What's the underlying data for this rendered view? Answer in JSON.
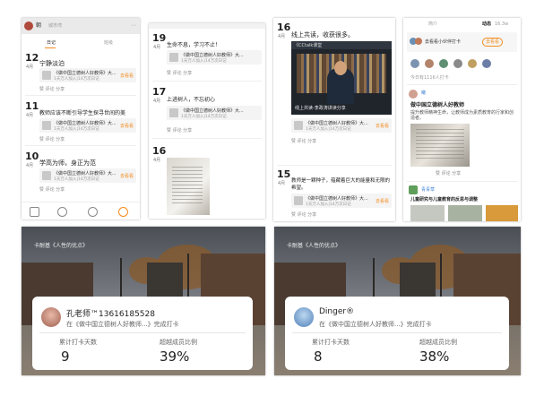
{
  "panel1": {
    "user": "朝",
    "user_sub": "城市湾",
    "tabs": [
      "日记",
      "班级"
    ],
    "entries": [
      {
        "day": "12",
        "month": "4月",
        "text": "宁静淡泊",
        "card_l1": "《做中国立德树人好教师》大...",
        "card_l2": "1天万人加入|14万次日记",
        "actions": "赞  评论  分享",
        "go": "去看看"
      },
      {
        "day": "11",
        "month": "4月",
        "text": "教师应该不断引导学生探寻世间的美",
        "card_l1": "《做中国立德树人好教师》大...",
        "card_l2": "1天万人加入|14万次日记",
        "actions": "赞  评论  分享",
        "go": "去看看"
      },
      {
        "day": "10",
        "month": "4月",
        "text": "学高为师，身正为范",
        "card_l1": "《做中国立德树人好教师》大...",
        "card_l2": "1天万人加入|14万次日记",
        "actions": "赞  评论  分享",
        "go": "去看看"
      }
    ]
  },
  "panel2": {
    "entries": [
      {
        "day": "19",
        "month": "4月",
        "text": "生命不息，学习不止！",
        "card_l1": "《做中国立德树人好教师》大...",
        "card_l2": "1天万人加入|14万次日记",
        "actions": "赞  评论  分享"
      },
      {
        "day": "17",
        "month": "4月",
        "text": "上进树人，不忘初心",
        "card_l1": "《做中国立德树人好教师》大...",
        "card_l2": "1天万人加入|14万次日记",
        "actions": "赞  评论  分享"
      },
      {
        "day": "16",
        "month": "4月",
        "text": "",
        "card_l1": "",
        "card_l2": "",
        "actions": ""
      }
    ]
  },
  "panel3": {
    "entries": [
      {
        "day": "16",
        "month": "4月",
        "text": "线上共读，收获很多。",
        "video_bar": "《CCtalk课堂",
        "caption": "线上共读-李政涛讲读分享",
        "card_l1": "《做中国立德树人好教师》大...",
        "card_l2": "1天万人加入|14万次日记",
        "actions": "赞  评论  分享",
        "go": "去看看"
      },
      {
        "day": "15",
        "month": "4月",
        "text": "教师是一颗种子，蕴藏着巨大的能量和无限的希望。",
        "card_l1": "《做中国立德树人好教师》大...",
        "card_l2": "1天万人加入|14万次日记",
        "actions": "赞  评论  分享",
        "go": "去看看"
      }
    ]
  },
  "panel4": {
    "tab_left": "简介",
    "tab_right": "动态",
    "right_count": "16.3w",
    "header_text": "去看看小伙伴打卡",
    "follow": "去看看",
    "today_text": "今日有1116人打卡",
    "posts": [
      {
        "name": "曦",
        "title": "做中国立德树人好教师",
        "text": "提升教师精神生命，让教师成为素质教育的行家和创造者。",
        "actions": "赞  评论  分享"
      },
      {
        "name": "青青草",
        "title": "儿童研究与儿童教育的反思与调整",
        "text": "",
        "actions": ""
      }
    ]
  },
  "panel5": {
    "header": "卡耐基《人性的优点》",
    "teacher_name": "孔老师™13616185528",
    "checkin_text": "在《做中国立德树人好教师...》完成打卡",
    "label_days": "累计打卡天数",
    "label_ratio": "超越成员比例",
    "days": "9",
    "ratio": "39%"
  },
  "panel6": {
    "header": "卡耐基《人性的优点》",
    "teacher_name": "Dinger®",
    "checkin_text": "在《做中国立德树人好教师...》完成打卡",
    "label_days": "累计打卡天数",
    "label_ratio": "超越成员比例",
    "days": "8",
    "ratio": "38%"
  },
  "colors": {
    "accent": "#f28b1e",
    "blue": "#3b7fd4"
  }
}
